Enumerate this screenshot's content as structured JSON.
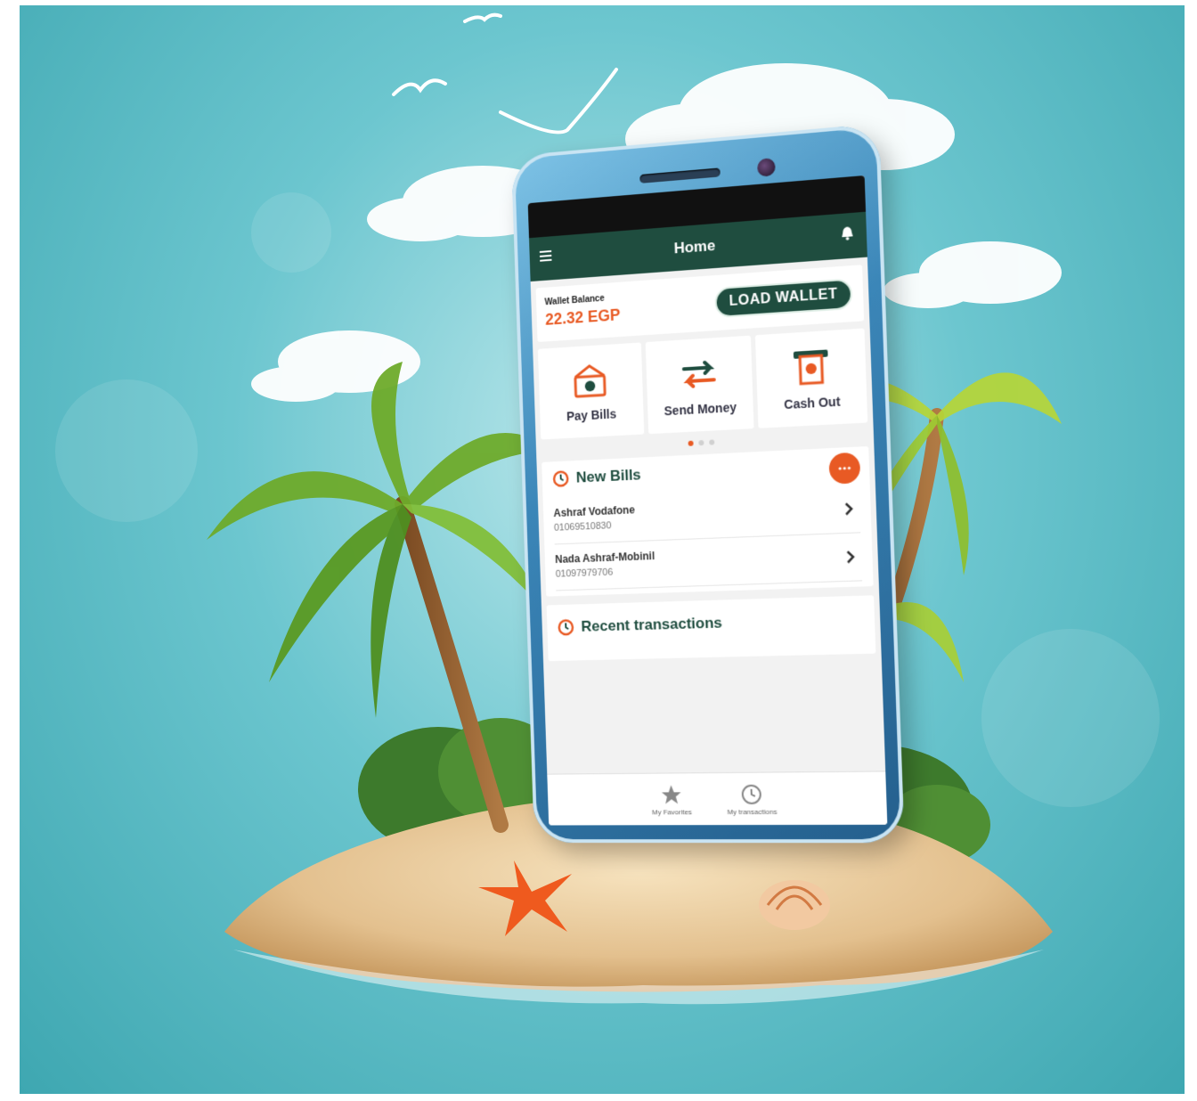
{
  "app": {
    "title": "Home"
  },
  "wallet": {
    "label": "Wallet Balance",
    "amount": "22.32 EGP",
    "load_button": "LOAD WALLET"
  },
  "actions": [
    {
      "label": "Pay Bills",
      "icon": "pay-bills-icon"
    },
    {
      "label": "Send Money",
      "icon": "send-money-icon"
    },
    {
      "label": "Cash Out",
      "icon": "cash-out-icon"
    }
  ],
  "carousel": {
    "active_index": 0,
    "count": 3
  },
  "new_bills": {
    "title": "New Bills",
    "items": [
      {
        "name": "Ashraf Vodafone",
        "number": "01069510830"
      },
      {
        "name": "Nada Ashraf-Mobinil",
        "number": "01097979706"
      }
    ]
  },
  "recent": {
    "title": "Recent transactions"
  },
  "bottom_nav": [
    {
      "label": "My Favorites",
      "icon": "star-icon"
    },
    {
      "label": "My transactions",
      "icon": "clock-icon"
    }
  ],
  "colors": {
    "brand_green": "#1f4d3f",
    "accent_orange": "#e85a24",
    "sky": "#6cc6cf"
  }
}
